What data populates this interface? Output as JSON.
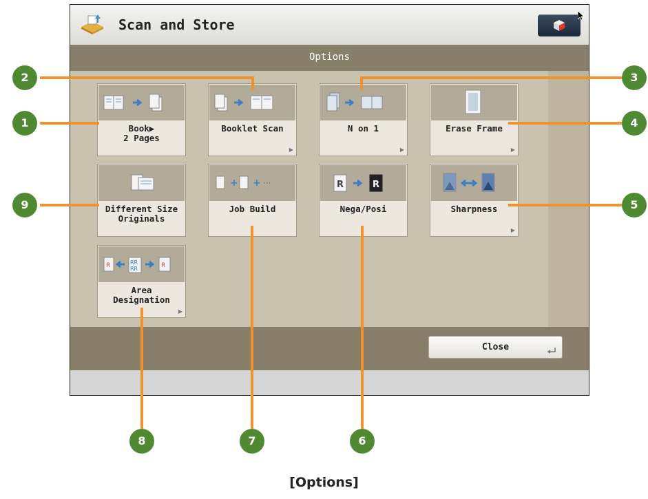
{
  "header": {
    "title": "Scan and Store",
    "app_icon": "scan-and-store-icon",
    "status_icon": "status-monitor-icon"
  },
  "options_bar": {
    "title": "Options"
  },
  "tiles": [
    {
      "label": "Book▶\n2 Pages",
      "icon": "book-to-2-pages-icon"
    },
    {
      "label": "Booklet Scan",
      "icon": "booklet-scan-icon"
    },
    {
      "label": "N on 1",
      "icon": "n-on-1-icon"
    },
    {
      "label": "Erase Frame",
      "icon": "erase-frame-icon"
    },
    {
      "label": "Different Size\nOriginals",
      "icon": "different-size-originals-icon"
    },
    {
      "label": "Job Build",
      "icon": "job-build-icon"
    },
    {
      "label": "Nega/Posi",
      "icon": "nega-posi-icon"
    },
    {
      "label": "Sharpness",
      "icon": "sharpness-icon"
    },
    {
      "label": "Area\nDesignation",
      "icon": "area-designation-icon"
    }
  ],
  "close_button": {
    "label": "Close"
  },
  "callouts": [
    "1",
    "2",
    "3",
    "4",
    "5",
    "6",
    "7",
    "8",
    "9"
  ],
  "caption": "[Options]",
  "colors": {
    "callout_green": "#4f8a33",
    "callout_orange": "#f0922d",
    "bar_brown": "#877f6a"
  }
}
